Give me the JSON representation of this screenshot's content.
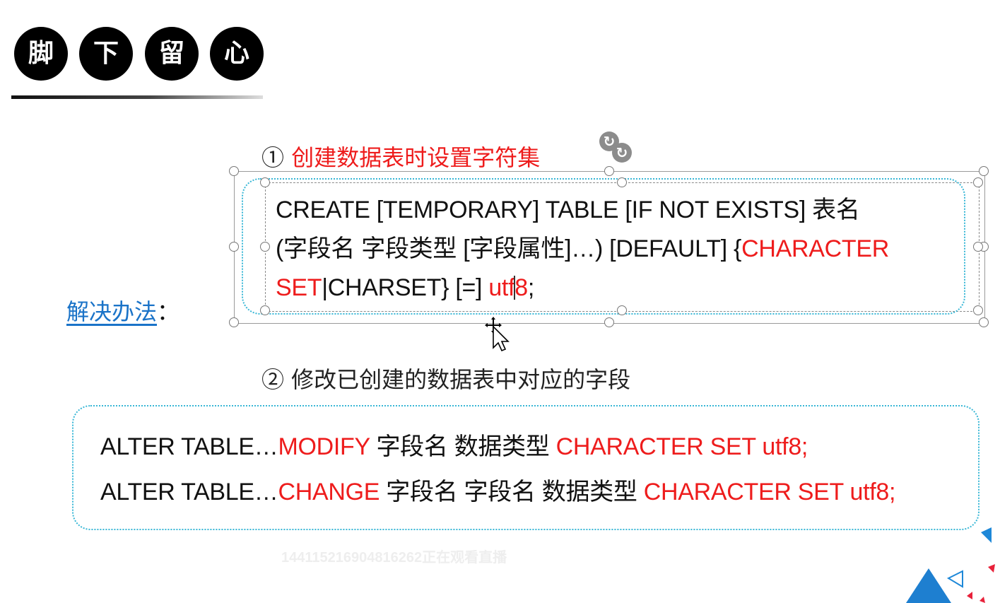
{
  "header": {
    "circles": [
      "脚",
      "下",
      "留",
      "心"
    ]
  },
  "solution_label": "解决办法",
  "solution_colon": "：",
  "step1": {
    "number": "①",
    "title": "创建数据表时设置字符集",
    "code": {
      "line1": "CREATE [TEMPORARY] TABLE [IF NOT EXISTS] 表名",
      "line2_black": "(字段名 字段类型 [字段属性]…) [DEFAULT] {",
      "line2_red": "CHARACTER",
      "line3_red1": "SET",
      "line3_black1": "|CHARSET} [=] ",
      "line3_red2a": "utf",
      "line3_red2b": "8",
      "line3_black2": ";"
    }
  },
  "step2": {
    "title": "② 修改已创建的数据表中对应的字段",
    "code": {
      "line1_black1": "ALTER TABLE…",
      "line1_red1": "MODIFY",
      "line1_black2": " 字段名 数据类型 ",
      "line1_red2": "CHARACTER SET utf8;",
      "line2_black1": "ALTER TABLE…",
      "line2_red1": "CHANGE",
      "line2_black2": " 字段名 字段名 数据类型 ",
      "line2_red2": "CHARACTER SET utf8;"
    }
  },
  "watermark": "14411521690481626​2正在观看直播",
  "colors": {
    "accent_red": "#ee1c1c",
    "link_blue": "#1a73c8",
    "dotted_border": "#39b7d6",
    "deco_blue": "#1e88d8"
  },
  "icons": {
    "rotate_handle": "rotate-icon",
    "mouse_cursor": "move-cursor-icon"
  }
}
